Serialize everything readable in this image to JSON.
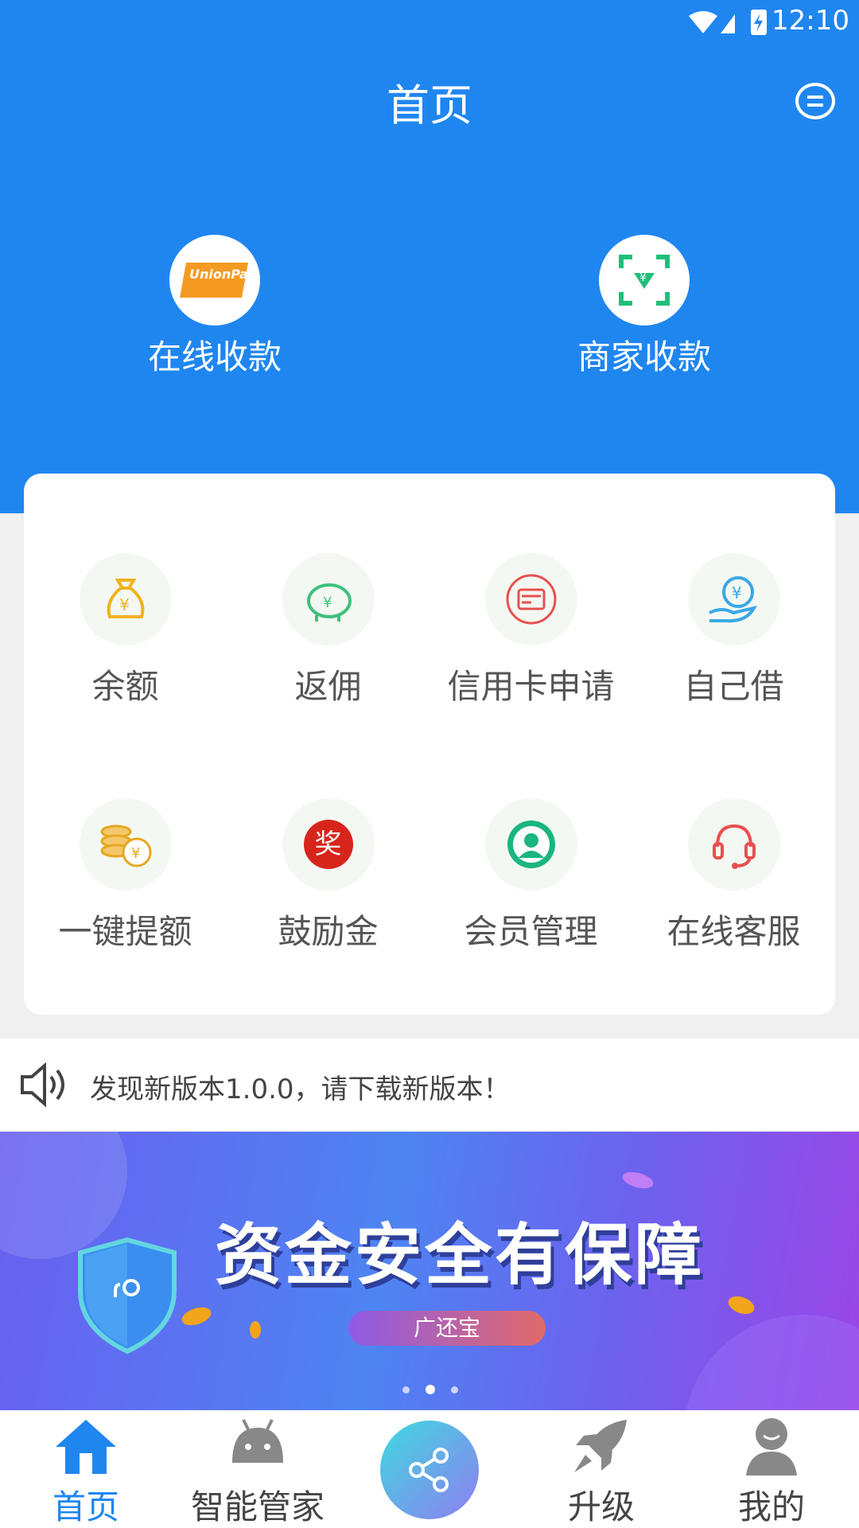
{
  "status_bar": {
    "time": "12:10"
  },
  "header": {
    "title": "首页"
  },
  "payments": [
    {
      "label": "在线收款",
      "icon": "unionpay-icon",
      "badge_text": "UnionPay 银联"
    },
    {
      "label": "商家收款",
      "icon": "scan-yuan-icon"
    }
  ],
  "services": [
    {
      "label": "余额",
      "icon": "money-bag-icon"
    },
    {
      "label": "返佣",
      "icon": "piggy-bank-icon"
    },
    {
      "label": "信用卡申请",
      "icon": "credit-card-icon"
    },
    {
      "label": "自己借",
      "icon": "hand-yuan-icon"
    },
    {
      "label": "一键提额",
      "icon": "coins-icon"
    },
    {
      "label": "鼓励金",
      "icon": "reward-icon",
      "glyph": "奖"
    },
    {
      "label": "会员管理",
      "icon": "member-icon"
    },
    {
      "label": "在线客服",
      "icon": "headset-icon"
    }
  ],
  "notice": {
    "text": "发现新版本1.0.0，请下载新版本！",
    "icon": "speaker-icon"
  },
  "banner": {
    "title": "资金安全有保障",
    "tag": "广还宝",
    "active_slide": 2,
    "slides": 3
  },
  "tabbar": [
    {
      "label": "首页",
      "icon": "home-icon",
      "active": true
    },
    {
      "label": "智能管家",
      "icon": "android-icon",
      "active": false
    },
    {
      "label": "",
      "icon": "share-icon",
      "active": false
    },
    {
      "label": "升级",
      "icon": "rocket-icon",
      "active": false
    },
    {
      "label": "我的",
      "icon": "user-icon",
      "active": false
    }
  ],
  "colors": {
    "primary": "#1f86f0",
    "background": "#f0f0f0",
    "reward_red": "#d8251c",
    "member_green": "#1bb57f"
  }
}
